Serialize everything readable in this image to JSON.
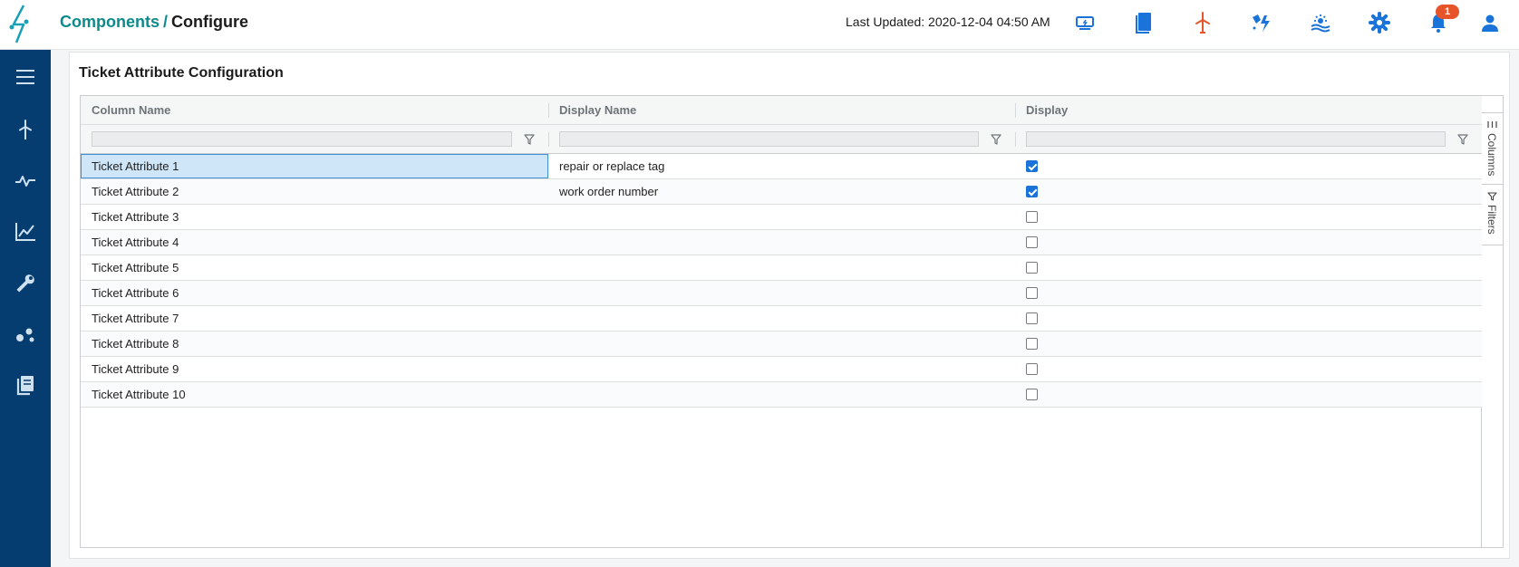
{
  "header": {
    "breadcrumb_link": "Components",
    "breadcrumb_sep": "/",
    "breadcrumb_current": "Configure",
    "last_updated": "Last Updated: 2020-12-04 04:50 AM",
    "notification_count": "1",
    "icons": [
      "monitor-icon",
      "book-icon",
      "wind-turbine-icon",
      "weather-lightning-icon",
      "solar-icon",
      "gear-icon",
      "bell-icon",
      "user-icon"
    ]
  },
  "sidebar": {
    "icons": [
      "menu-icon",
      "wind-turbine-icon",
      "pulse-icon",
      "line-chart-icon",
      "wrench-icon",
      "scatter-icon",
      "documents-icon"
    ]
  },
  "panel": {
    "title": "Ticket Attribute Configuration"
  },
  "grid": {
    "columns": [
      "Column Name",
      "Display Name",
      "Display"
    ],
    "rows": [
      {
        "column_name": "Ticket Attribute 1",
        "display_name": "repair or replace tag",
        "display": true
      },
      {
        "column_name": "Ticket Attribute 2",
        "display_name": "work order number",
        "display": true
      },
      {
        "column_name": "Ticket Attribute 3",
        "display_name": "",
        "display": false
      },
      {
        "column_name": "Ticket Attribute 4",
        "display_name": "",
        "display": false
      },
      {
        "column_name": "Ticket Attribute 5",
        "display_name": "",
        "display": false
      },
      {
        "column_name": "Ticket Attribute 6",
        "display_name": "",
        "display": false
      },
      {
        "column_name": "Ticket Attribute 7",
        "display_name": "",
        "display": false
      },
      {
        "column_name": "Ticket Attribute 8",
        "display_name": "",
        "display": false
      },
      {
        "column_name": "Ticket Attribute 9",
        "display_name": "",
        "display": false
      },
      {
        "column_name": "Ticket Attribute 10",
        "display_name": "",
        "display": false
      }
    ],
    "tool_panel": {
      "columns_label": "Columns",
      "filters_label": "Filters"
    }
  },
  "colors": {
    "sidebar": "#063d70",
    "brand_teal": "#0d8a8a",
    "icon_blue": "#1a73d9",
    "icon_orange": "#e8542a",
    "selection": "#cfe6f8"
  }
}
